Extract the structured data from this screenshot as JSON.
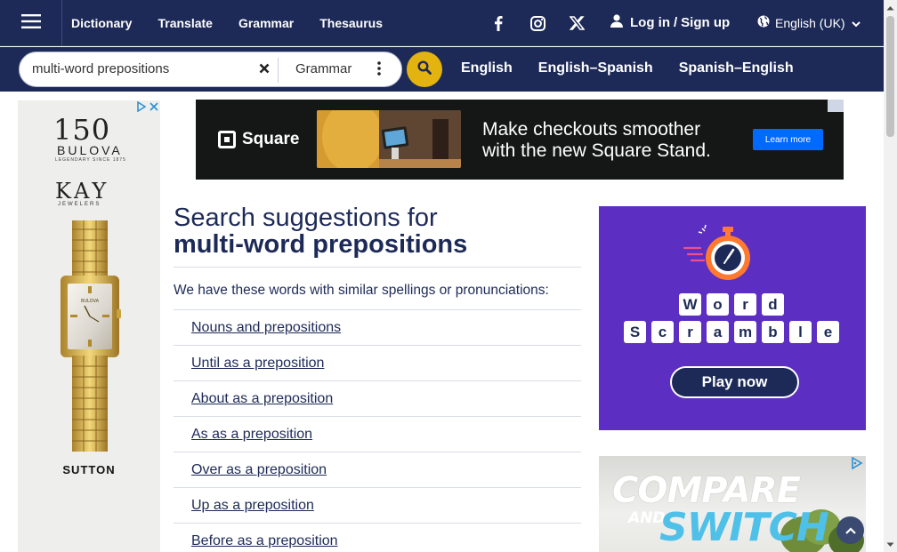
{
  "nav": {
    "links": [
      "Dictionary",
      "Translate",
      "Grammar",
      "Thesaurus"
    ],
    "login_label": "Log in",
    "login_sep": "/",
    "signup_label": "Sign up",
    "language": "English (UK)"
  },
  "search": {
    "query": "multi-word prepositions",
    "dictionary": "Grammar",
    "dict_links": [
      "English",
      "English–Spanish",
      "Spanish–English"
    ]
  },
  "left_ad": {
    "bulova_number": "150",
    "bulova_name": "BULOVA",
    "bulova_tagline": "LEGENDARY SINCE 1875",
    "kay_name": "KAY",
    "kay_sub": "JEWELERS",
    "watch_brand": "BULOVA",
    "product_name": "SUTTON"
  },
  "top_ad": {
    "brand": "Square",
    "headline_line1": "Make checkouts smoother",
    "headline_line2": "with the new Square Stand.",
    "cta": "Learn more"
  },
  "main": {
    "heading_line1": "Search suggestions for",
    "heading_line2": "multi-word prepositions",
    "intro": "We have these words with similar spellings or pronunciations:",
    "suggestions": [
      "Nouns and prepositions",
      "Until as a preposition",
      "About as a preposition",
      "As as a preposition",
      "Over as a preposition",
      "Up as a preposition",
      "Before as a preposition"
    ]
  },
  "word_scramble_ad": {
    "row1": [
      "W",
      "o",
      "r",
      "d"
    ],
    "row2": [
      "S",
      "c",
      "r",
      "a",
      "m",
      "b",
      "l",
      "e"
    ],
    "cta": "Play now"
  },
  "compare_ad": {
    "line1": "COMPARE",
    "and": "AND",
    "line2": "SWITCH"
  },
  "colors": {
    "navy": "#1d2a57",
    "search_button": "#e3b410",
    "scramble_purple": "#5c2ec2",
    "square_blue": "#006aff"
  },
  "icons": [
    "menu-icon",
    "facebook-icon",
    "instagram-icon",
    "x-icon",
    "user-icon",
    "globe-icon",
    "chevron-down-icon",
    "clear-icon",
    "more-vertical-icon",
    "search-icon",
    "adchoices-icon",
    "stopwatch-icon",
    "arrow-up-icon"
  ]
}
